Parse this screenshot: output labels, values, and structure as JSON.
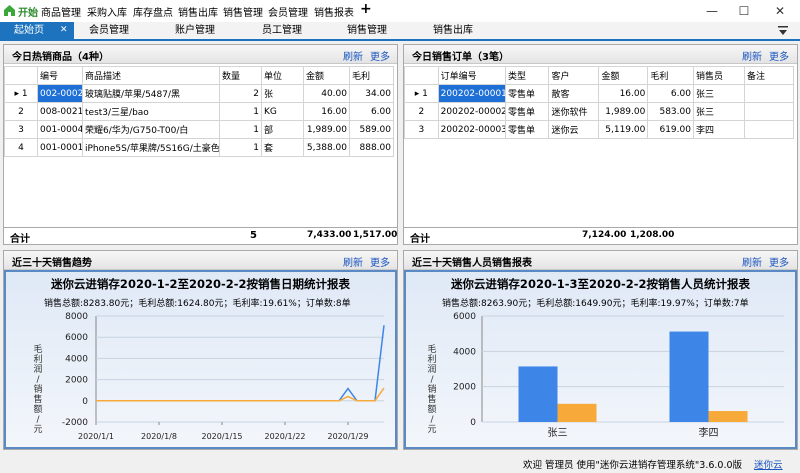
{
  "menu": {
    "start": "开始",
    "items": [
      "商品管理",
      "采购入库",
      "库存盘点",
      "销售出库",
      "销售管理",
      "会员管理",
      "销售报表"
    ],
    "add": "+",
    "minimize": "—",
    "maximize": "☐",
    "close": "✕"
  },
  "tabs": {
    "items": [
      "起始页",
      "会员管理",
      "账户管理",
      "员工管理",
      "销售管理",
      "销售出库"
    ],
    "close": "✕"
  },
  "hot_goods": {
    "title": "今日热销商品（4种）",
    "refresh": "刷新",
    "more": "更多",
    "columns": [
      "编号",
      "商品描述",
      "数量",
      "单位",
      "金额",
      "毛利"
    ],
    "rows": [
      {
        "no": "002-0002",
        "desc": "玻璃贴膜/苹果/5487/黑",
        "qty": "2",
        "unit": "张",
        "amount": "40.00",
        "profit": "34.00"
      },
      {
        "no": "008-0021",
        "desc": "test3/三星/bao",
        "qty": "1",
        "unit": "KG",
        "amount": "16.00",
        "profit": "6.00"
      },
      {
        "no": "001-0004",
        "desc": "荣耀6/华为/G750-T00/白",
        "qty": "1",
        "unit": "部",
        "amount": "1,989.00",
        "profit": "589.00"
      },
      {
        "no": "001-0001",
        "desc": "iPhone5S/苹果牌/5S16G/土豪色",
        "qty": "1",
        "unit": "套",
        "amount": "5,388.00",
        "profit": "888.00"
      }
    ],
    "total_label": "合计",
    "total_qty": "5",
    "total_amount": "7,433.00",
    "total_profit": "1,517.00"
  },
  "sales_orders": {
    "title": "今日销售订单（3笔）",
    "refresh": "刷新",
    "more": "更多",
    "columns": [
      "订单编号",
      "类型",
      "客户",
      "金额",
      "毛利",
      "销售员",
      "备注"
    ],
    "rows": [
      {
        "no": "200202-00001",
        "type": "零售单",
        "customer": "散客",
        "amount": "16.00",
        "profit": "6.00",
        "seller": "张三",
        "note": ""
      },
      {
        "no": "200202-00002",
        "type": "零售单",
        "customer": "迷你软件",
        "amount": "1,989.00",
        "profit": "583.00",
        "seller": "张三",
        "note": ""
      },
      {
        "no": "200202-00003",
        "type": "零售单",
        "customer": "迷你云",
        "amount": "5,119.00",
        "profit": "619.00",
        "seller": "李四",
        "note": ""
      }
    ],
    "total_label": "合计",
    "total_amount": "7,124.00",
    "total_profit": "1,208.00"
  },
  "trend": {
    "panel_title": "近三十天销售趋势",
    "refresh": "刷新",
    "more": "更多"
  },
  "seller_report": {
    "panel_title": "近三十天销售人员销售报表",
    "refresh": "刷新",
    "more": "更多"
  },
  "chart_data": [
    {
      "type": "line",
      "title": "迷你云进销存2020-1-2至2020-2-2按销售日期统计报表",
      "subtitle": "销售总额:8283.80元；毛利总额:1624.80元；毛利率:19.61%；订单数:8单",
      "ylabel": "毛利润/销售额/元",
      "ylim": [
        -2000,
        8000
      ],
      "yticks": [
        "8000",
        "6000",
        "4000",
        "2000",
        "0",
        "-2000"
      ],
      "xticks": [
        "2020/1/1",
        "2020/1/8",
        "2020/1/15",
        "2020/1/22",
        "2020/1/29"
      ],
      "colors": {
        "sales": "#3d86e8",
        "profit": "#f7a93a"
      },
      "series": [
        {
          "key": "sales",
          "values": [
            0,
            0,
            0,
            0,
            0,
            0,
            0,
            0,
            0,
            0,
            0,
            0,
            0,
            0,
            0,
            0,
            0,
            0,
            0,
            0,
            0,
            0,
            0,
            0,
            0,
            0,
            0,
            0,
            1160,
            0,
            0,
            0,
            7124
          ]
        },
        {
          "key": "profit",
          "values": [
            0,
            0,
            0,
            0,
            0,
            0,
            0,
            0,
            0,
            0,
            0,
            0,
            0,
            0,
            0,
            0,
            0,
            0,
            0,
            0,
            0,
            0,
            0,
            0,
            0,
            0,
            0,
            0,
            417,
            0,
            0,
            0,
            1208
          ]
        }
      ]
    },
    {
      "type": "bar",
      "title": "迷你云进销存2020-1-3至2020-2-2按销售人员统计报表",
      "subtitle": "销售总额:8263.90元；毛利总额:1649.90元；毛利率:19.97%；订单数:7单",
      "ylabel": "毛利润/销售额/元",
      "ylim": [
        0,
        6000
      ],
      "yticks": [
        "6000",
        "4000",
        "2000",
        "0"
      ],
      "categories": [
        "张三",
        "李四"
      ],
      "colors": {
        "sales": "#3d86e8",
        "profit": "#f7a93a"
      },
      "series": [
        {
          "key": "sales",
          "values": [
            3145,
            5119
          ]
        },
        {
          "key": "profit",
          "values": [
            1030,
            620
          ]
        }
      ]
    }
  ],
  "status": {
    "text": "欢迎 管理员 使用\"迷你云进销存管理系统\"3.6.0.0版",
    "link": "迷你云"
  }
}
